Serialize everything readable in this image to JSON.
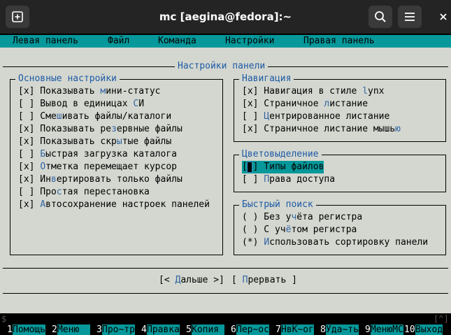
{
  "window": {
    "title": "mc [aegina@fedora]:~"
  },
  "menubar": {
    "items": [
      "Левая панель",
      "Файл",
      "Команда",
      "Настройки",
      "Правая панель"
    ]
  },
  "dialog": {
    "title": "Настройки панели",
    "main_settings": {
      "title": "Основные настройки",
      "items": [
        {
          "mark": "[x]",
          "label": "Показывать мини-статус",
          "checked": true
        },
        {
          "mark": "[ ]",
          "label": "Вывод в единицах СИ",
          "checked": false
        },
        {
          "mark": "[ ]",
          "label": "Смешивать файлы/каталоги",
          "checked": false
        },
        {
          "mark": "[x]",
          "label": "Показывать резервные файлы",
          "checked": true
        },
        {
          "mark": "[x]",
          "label": "Показывать скрытые файлы",
          "checked": true
        },
        {
          "mark": "[ ]",
          "label": "Быстрая загрузка каталога",
          "checked": false
        },
        {
          "mark": "[x]",
          "label": "Отметка перемещает курсор",
          "checked": true
        },
        {
          "mark": "[x]",
          "label": "Инвертировать только файлы",
          "checked": true
        },
        {
          "mark": "[ ]",
          "label": "Простая перестановка",
          "checked": false
        },
        {
          "mark": "[x]",
          "label": "Автосохранение настроек панелей",
          "checked": true
        }
      ]
    },
    "navigation": {
      "title": "Навигация",
      "items": [
        {
          "mark": "[x]",
          "label": "Навигация в стиле lynx",
          "checked": true
        },
        {
          "mark": "[x]",
          "label": "Страничное листание",
          "checked": true
        },
        {
          "mark": "[ ]",
          "label": "Центрированное листание",
          "checked": false
        },
        {
          "mark": "[x]",
          "label": "Страничное листание мышью",
          "checked": true
        }
      ]
    },
    "highlighting": {
      "title": "Цветовыделение",
      "items": [
        {
          "mark": "[ ]",
          "label": "Типы файлов",
          "checked": false
        },
        {
          "mark": "[ ]",
          "label": "Права доступа",
          "checked": false
        }
      ]
    },
    "quick_search": {
      "title": "Быстрый поиск",
      "items": [
        {
          "mark": "( )",
          "label": "Без учёта регистра",
          "selected": false
        },
        {
          "mark": "( )",
          "label": "С учётом регистра",
          "selected": false
        },
        {
          "mark": "(*)",
          "label": "Использовать сортировку панели",
          "selected": true
        }
      ]
    },
    "buttons": {
      "next_open": "[< ",
      "next_label": "Дальше",
      "next_close": " >]",
      "cancel_open": "[ ",
      "cancel_label": "Прервать",
      "cancel_close": " ]"
    }
  },
  "cmdline": {
    "prompt": "$",
    "right": "[^]"
  },
  "fkeys": [
    {
      "num": "1",
      "label": "Помощь"
    },
    {
      "num": "2",
      "label": "Меню  "
    },
    {
      "num": "3",
      "label": "Про~тр"
    },
    {
      "num": "4",
      "label": "Правка"
    },
    {
      "num": "5",
      "label": "Копия "
    },
    {
      "num": "6",
      "label": "Пер~ос"
    },
    {
      "num": "7",
      "label": "НвК~ог"
    },
    {
      "num": "8",
      "label": "Уда~ть"
    },
    {
      "num": "9",
      "label": "МенюМС"
    },
    {
      "num": "10",
      "label": "Выход"
    }
  ],
  "colors": {
    "titlebar": "#242424",
    "menubar": "#06989a",
    "dialog_bg": "#d3d7cf",
    "hotkey": "#3465a4",
    "group_title": "#1f5aa6"
  }
}
